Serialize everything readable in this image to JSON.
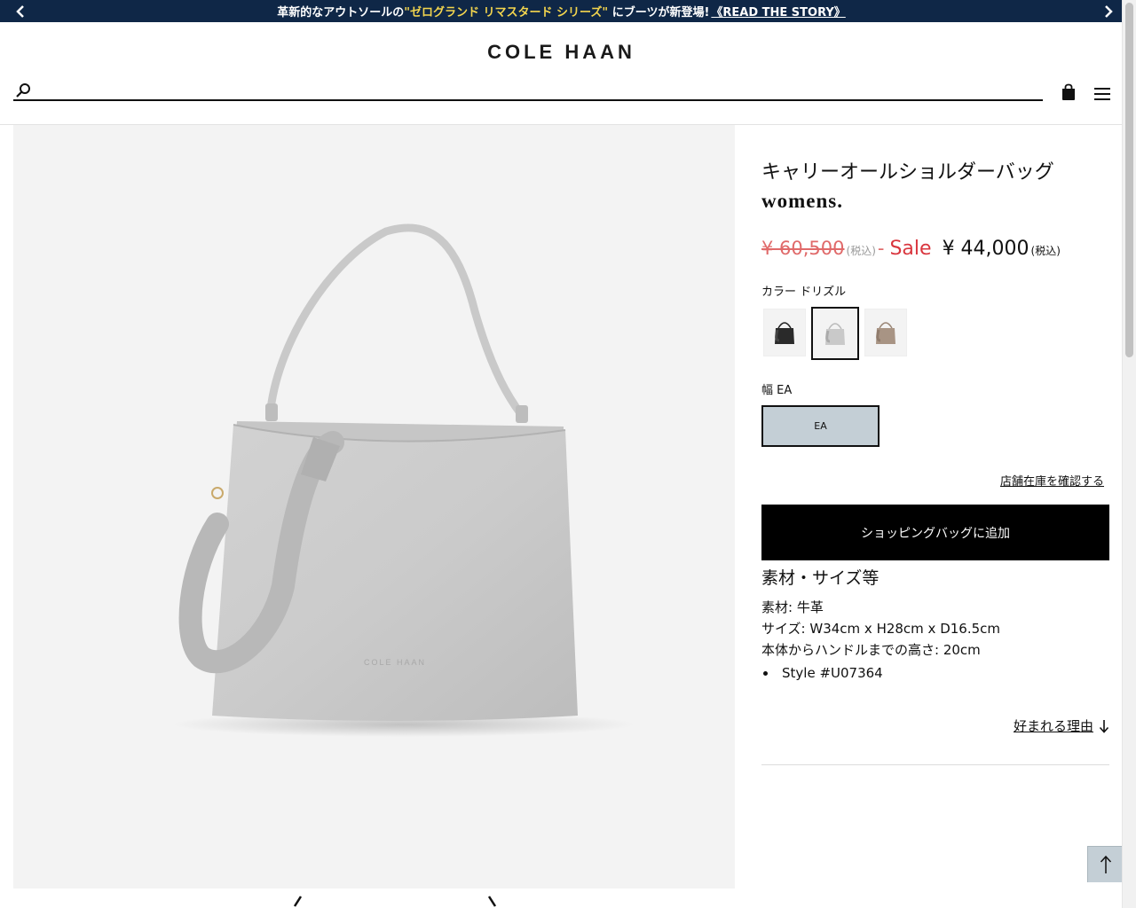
{
  "promo": {
    "prefix": "革新的なアウトソールの",
    "highlight": "\"ゼログランド リマスタード シリーズ\"",
    "suffix": " にブーツが新登場!",
    "link_text": "《READ THE STORY》",
    "prev_icon": "chevron-left-icon",
    "next_icon": "chevron-right-icon",
    "background": "#0f2747",
    "highlight_color": "#f3d54e"
  },
  "header": {
    "logo": "COLE HAAN",
    "search": {
      "value": "",
      "placeholder": "",
      "icon": "search-icon"
    },
    "cart_icon": "shopping-bag-icon",
    "menu_icon": "hamburger-menu-icon"
  },
  "gallery": {
    "image_subject": "light grey leather shoulder bag",
    "bag_brand_emboss": "COLE HAAN",
    "prev_icon": "chevron-left-icon",
    "next_icon": "chevron-right-icon"
  },
  "product": {
    "name_ja": "キャリーオールショルダーバッグ",
    "gender": "womens.",
    "original_price": "¥ 60,500",
    "tax_note": "(税込)",
    "price_separator": "-",
    "sale_label": "Sale",
    "sale_price": "¥ 44,000",
    "sale_tax_note": "(税込)",
    "color_label": "カラー ドリズル",
    "swatches": [
      {
        "color": "#2a2a2a",
        "selected": false
      },
      {
        "color": "#c9c9c9",
        "selected": true
      },
      {
        "color": "#a89484",
        "selected": false
      }
    ],
    "width_label": "幅 EA",
    "width_option": "EA",
    "store_stock_link": "店舗在庫を確認する",
    "add_to_bag": "ショッピングバッグに追加",
    "spec_heading": "素材・サイズ等",
    "spec_material": "素材: 牛革",
    "spec_size": "サイズ: W34cm x H28cm x D16.5cm",
    "spec_handle": "本体からハンドルまでの高さ: 20cm",
    "style_number": "Style #U07364",
    "why_loved": "好まれる理由",
    "why_loved_icon": "arrow-down-icon"
  },
  "back_to_top_icon": "arrow-up-icon",
  "colors": {
    "sale_red": "#d9363e",
    "button_black": "#000000",
    "option_selected_bg": "#c4cfd6"
  }
}
